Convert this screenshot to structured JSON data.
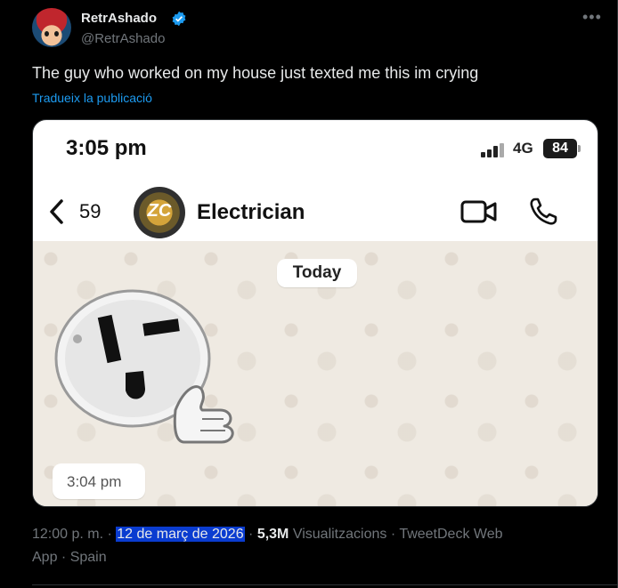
{
  "author": {
    "display_name": "RetrAshado",
    "handle": "@RetrAshado",
    "verified": true,
    "verified_color": "#1d9bf0"
  },
  "menu": {
    "more_icon": "more-horizontal-icon"
  },
  "tweet": {
    "text": "The guy who worked on my house just texted me this im crying",
    "translate_label": "Tradueix la publicació"
  },
  "screenshot": {
    "status_time": "3:05 pm",
    "network": "4G",
    "battery": "84",
    "back_count": "59",
    "contact_name": "Electrician",
    "contact_avatar_text": "ZC",
    "date_chip": "Today",
    "message_time": "3:04 pm",
    "sticker": "thumbs-up outlet sticker"
  },
  "meta": {
    "time": "12:00 p. m.",
    "separator": " · ",
    "date": "12 de març de 2026",
    "views_count": "5,3M",
    "views_label": " Visualitzacions",
    "source_part1": "TweetDeck Web",
    "source_part2": "App",
    "location": "Spain"
  },
  "colors": {
    "background": "#000000",
    "text_primary": "#e7e9ea",
    "text_secondary": "#71767b",
    "link": "#1d9bf0",
    "selection": "#0a3cd0"
  }
}
